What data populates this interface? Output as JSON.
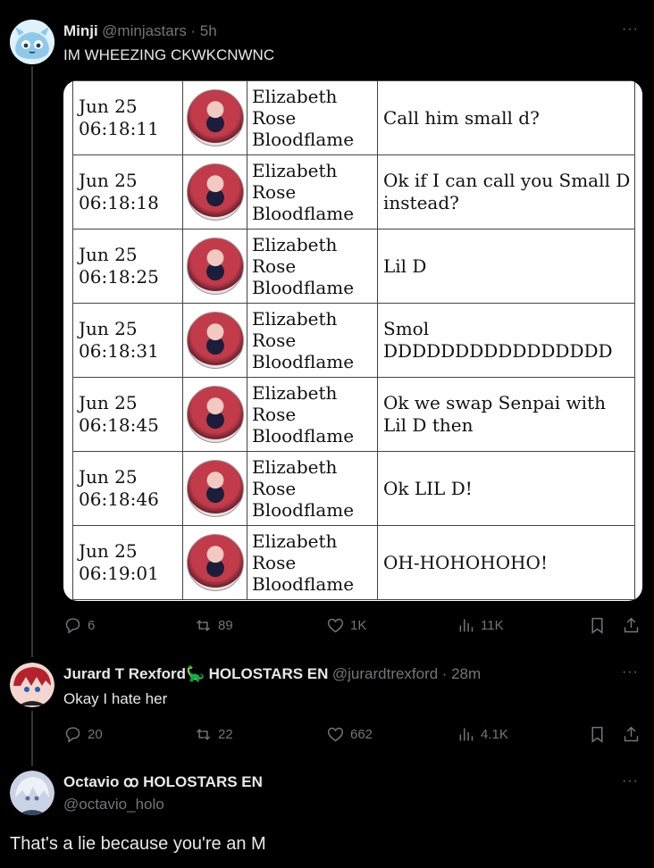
{
  "tweet1": {
    "display_name": "Minji",
    "handle": "@minjastars",
    "time": "· 5h",
    "more": "···",
    "text": "IM WHEEZING CKWKCNWNC",
    "actions": {
      "replies": "6",
      "reposts": "89",
      "likes": "1K",
      "views": "11K"
    }
  },
  "table": {
    "rows": [
      {
        "date": "Jun 25",
        "time": "06:18:11",
        "name": [
          "Elizabeth",
          "Rose",
          "Bloodflame"
        ],
        "msg": "Call him small d?"
      },
      {
        "date": "Jun 25",
        "time": "06:18:18",
        "name": [
          "Elizabeth",
          "Rose",
          "Bloodflame"
        ],
        "msg": "Ok if I can call you Small D instead?"
      },
      {
        "date": "Jun 25",
        "time": "06:18:25",
        "name": [
          "Elizabeth",
          "Rose",
          "Bloodflame"
        ],
        "msg": "Lil D"
      },
      {
        "date": "Jun 25",
        "time": "06:18:31",
        "name": [
          "Elizabeth",
          "Rose",
          "Bloodflame"
        ],
        "msg": "Smol DDDDDDDDDDDDDDDD"
      },
      {
        "date": "Jun 25",
        "time": "06:18:45",
        "name": [
          "Elizabeth",
          "Rose",
          "Bloodflame"
        ],
        "msg": "Ok we swap Senpai with Lil D then"
      },
      {
        "date": "Jun 25",
        "time": "06:18:46",
        "name": [
          "Elizabeth",
          "Rose",
          "Bloodflame"
        ],
        "msg": "Ok LIL D!"
      },
      {
        "date": "Jun 25",
        "time": "06:19:01",
        "name": [
          "Elizabeth",
          "Rose",
          "Bloodflame"
        ],
        "msg": "OH-HOHOHOHO!"
      }
    ]
  },
  "tweet2": {
    "display_name": "Jurard T Rexford",
    "emoji": "🦕",
    "display_suffix": "HOLOSTARS EN",
    "handle": "@jurardtrexford",
    "time": "· 28m",
    "more": "···",
    "text": "Okay I hate her",
    "actions": {
      "replies": "20",
      "reposts": "22",
      "likes": "662",
      "views": "4.1K"
    }
  },
  "tweet3": {
    "display_name": "Octavio ꝏ HOLOSTARS EN",
    "handle": "@octavio_holo",
    "more": "···",
    "text": "That's a lie because you're an M"
  },
  "colors": {
    "background": "#000000",
    "text": "#e7e9ea",
    "muted": "#71767b",
    "line": "#333639"
  }
}
